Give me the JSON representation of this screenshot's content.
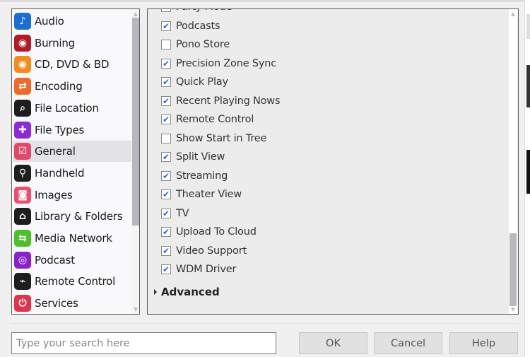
{
  "sidebar": {
    "items": [
      {
        "label": "Audio",
        "icon": "music-note-icon",
        "color": "#1a6fd0",
        "glyph": "♪"
      },
      {
        "label": "Burning",
        "icon": "burning-disc-icon",
        "color": "#b01c28",
        "glyph": "◉"
      },
      {
        "label": "CD, DVD & BD",
        "icon": "disc-icon",
        "color": "#f58a1f",
        "glyph": "◉"
      },
      {
        "label": "Encoding",
        "icon": "convert-arrows-icon",
        "color": "#ee6a2a",
        "glyph": "⇄"
      },
      {
        "label": "File Location",
        "icon": "file-search-icon",
        "color": "#1e1e1e",
        "glyph": "⌕"
      },
      {
        "label": "File Types",
        "icon": "puzzle-icon",
        "color": "#8a2ad8",
        "glyph": "✚"
      },
      {
        "label": "General",
        "icon": "checkbox-icon",
        "color": "#e04a6a",
        "glyph": "☑",
        "selected": true
      },
      {
        "label": "Handheld",
        "icon": "usb-icon",
        "color": "#1e1e1e",
        "glyph": "⚲"
      },
      {
        "label": "Images",
        "icon": "camera-icon",
        "color": "#e8506e",
        "glyph": "◙"
      },
      {
        "label": "Library & Folders",
        "icon": "home-music-icon",
        "color": "#1e1e1e",
        "glyph": "⌂"
      },
      {
        "label": "Media Network",
        "icon": "network-icon",
        "color": "#4cbf2a",
        "glyph": "⇆"
      },
      {
        "label": "Podcast",
        "icon": "podcast-icon",
        "color": "#8a22c8",
        "glyph": "◎"
      },
      {
        "label": "Remote Control",
        "icon": "remote-control-icon",
        "color": "#1e1e1e",
        "glyph": "⌁"
      },
      {
        "label": "Services",
        "icon": "plug-icon",
        "color": "#e0344e",
        "glyph": "⏻"
      }
    ]
  },
  "options": {
    "items": [
      {
        "label": "Party Mode",
        "checked": true
      },
      {
        "label": "Podcasts",
        "checked": true
      },
      {
        "label": "Pono Store",
        "checked": false
      },
      {
        "label": "Precision Zone Sync",
        "checked": true
      },
      {
        "label": "Quick Play",
        "checked": true
      },
      {
        "label": "Recent Playing Nows",
        "checked": true
      },
      {
        "label": "Remote Control",
        "checked": true
      },
      {
        "label": "Show Start in Tree",
        "checked": false
      },
      {
        "label": "Split View",
        "checked": true
      },
      {
        "label": "Streaming",
        "checked": true
      },
      {
        "label": "Theater View",
        "checked": true
      },
      {
        "label": "TV",
        "checked": true
      },
      {
        "label": "Upload To Cloud",
        "checked": true
      },
      {
        "label": "Video Support",
        "checked": true
      },
      {
        "label": "WDM Driver",
        "checked": true
      }
    ],
    "advanced_label": "Advanced"
  },
  "footer": {
    "search_placeholder": "Type your search here",
    "ok_label": "OK",
    "cancel_label": "Cancel",
    "help_label": "Help"
  },
  "colors": {
    "checkmark": "#1f6fd1",
    "selection": "#e3e3e6"
  }
}
